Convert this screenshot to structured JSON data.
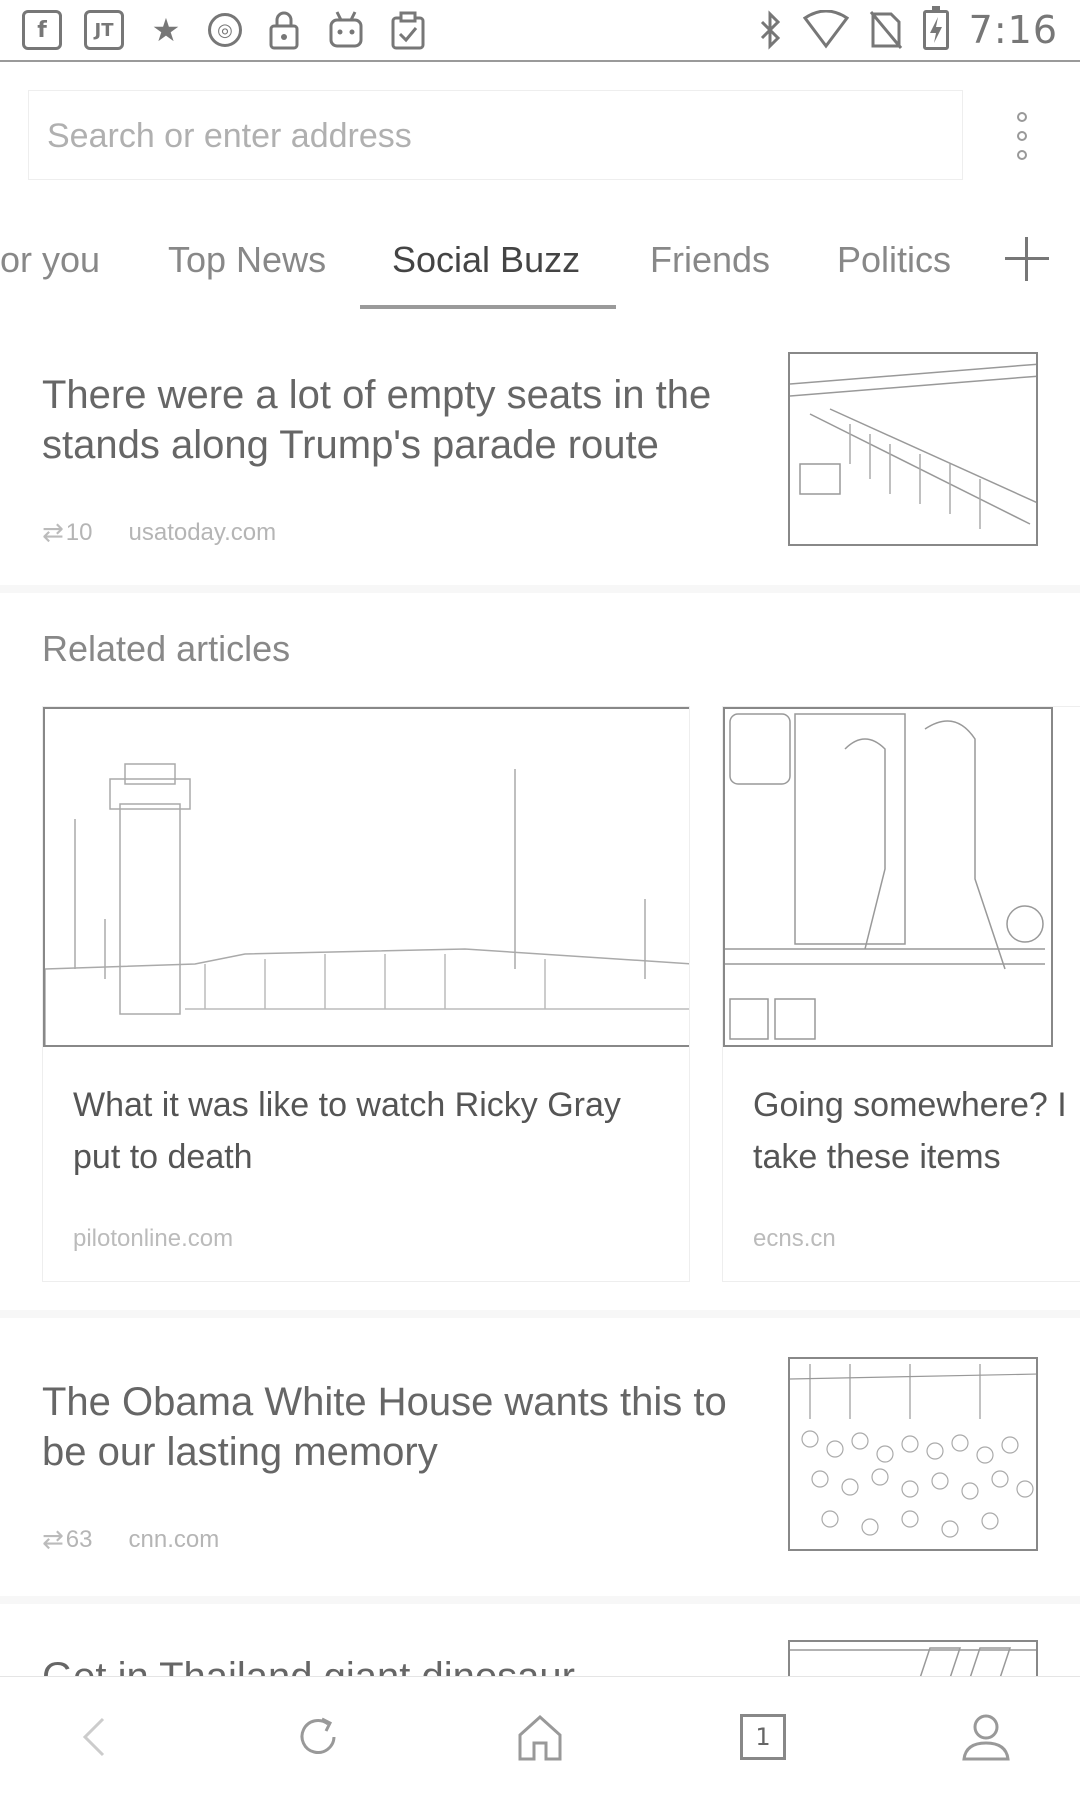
{
  "status_bar": {
    "left_icons": [
      "facebook-icon",
      "jt-icon",
      "jackie-chan-icon",
      "circle-icon",
      "lock-icon",
      "android-icon",
      "clipboard-check-icon"
    ],
    "left_glyphs": [
      "f",
      "JT",
      "★",
      "◎",
      "🔒",
      "◉",
      "✓"
    ],
    "right_icons": [
      "bluetooth-icon",
      "wifi-icon",
      "no-sim-icon",
      "battery-charging-icon"
    ],
    "right_glyphs": [
      "✱",
      "▽",
      "⧄",
      "⚡"
    ],
    "time": "7:16"
  },
  "search": {
    "placeholder": "Search or enter address"
  },
  "tabs": {
    "items": [
      "or you",
      "Top News",
      "Social Buzz",
      "Friends",
      "Politics"
    ],
    "active": "Social Buzz"
  },
  "articles": [
    {
      "title": "There were a lot of empty seats in the stands along Trump's parade route",
      "reposts": "10",
      "source": "usatoday.com"
    },
    {
      "title": "The Obama White House wants this to be our lasting memory",
      "reposts": "63",
      "source": "cnn.com"
    },
    {
      "title": "Get in Thailand giant dinosaur"
    }
  ],
  "related": {
    "heading": "Related articles",
    "cards": [
      {
        "title": "What it was like to watch Ricky Gray\nput to death",
        "source": "pilotonline.com"
      },
      {
        "title": "Going somewhere? I\ntake these items",
        "source": "ecns.cn"
      }
    ]
  },
  "bottom_nav": {
    "tab_count": "1",
    "icons": [
      "back-icon",
      "refresh-icon",
      "home-icon",
      "tabs-icon",
      "profile-icon"
    ]
  },
  "colors": {
    "background": "#ffffff",
    "text_dark": "#555555",
    "text_muted": "#b5b5b5",
    "rule": "#9a9a9a"
  }
}
